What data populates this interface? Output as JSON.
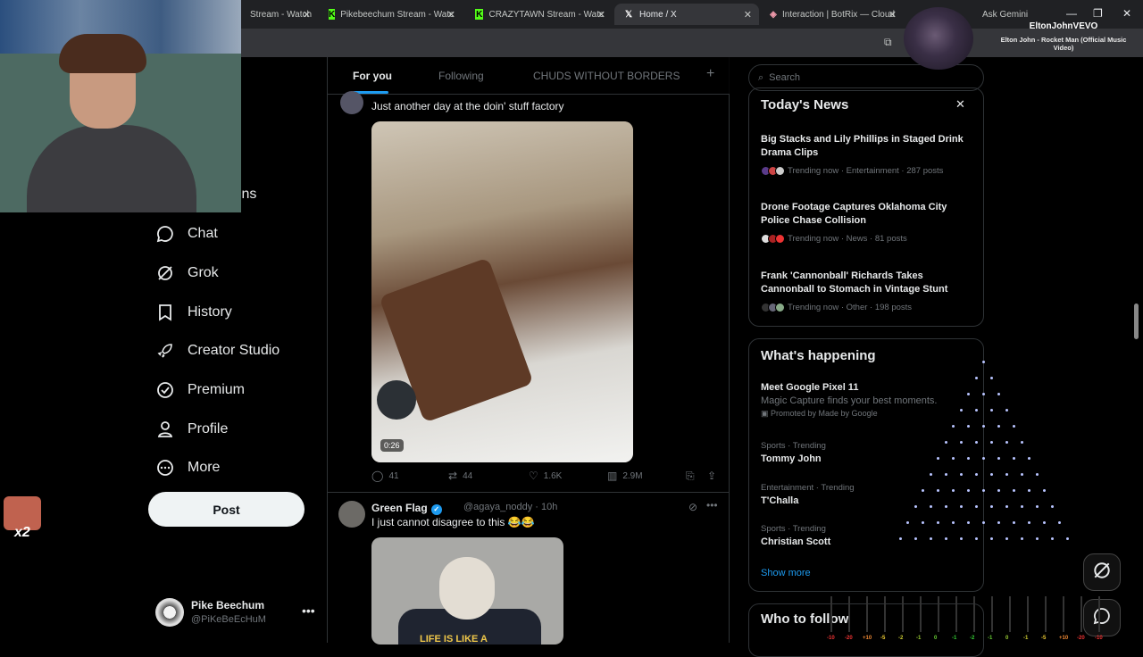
{
  "browser": {
    "tabs": [
      {
        "label": "Stream - Watch",
        "active": false
      },
      {
        "label": "Pikebeechum Stream - Watc",
        "active": false
      },
      {
        "label": "CRAZYTAWN Stream - Watc",
        "active": false
      },
      {
        "label": "Home / X",
        "active": true
      },
      {
        "label": "Interaction | BotRix — Cloud",
        "active": false
      }
    ],
    "ask_gemini": "Ask Gemini"
  },
  "now_playing": {
    "artist": "EltonJohnVEVO",
    "title": "Elton John - Rocket Man (Official Music Video)"
  },
  "nav": {
    "partial_label": "ions",
    "items": [
      {
        "label": "Chat",
        "icon": "chat-bubble-icon"
      },
      {
        "label": "Grok",
        "icon": "grok-icon"
      },
      {
        "label": "History",
        "icon": "bookmark-icon"
      },
      {
        "label": "Creator Studio",
        "icon": "rocket-icon"
      },
      {
        "label": "Premium",
        "icon": "verified-badge-icon"
      },
      {
        "label": "Profile",
        "icon": "person-icon"
      },
      {
        "label": "More",
        "icon": "more-circle-icon"
      }
    ],
    "post_label": "Post"
  },
  "account": {
    "name": "Pike Beechum",
    "handle": "@PiKeBeEcHuM"
  },
  "emote": {
    "count": "x2"
  },
  "feed": {
    "tabs": [
      "For you",
      "Following",
      "CHUDS WITHOUT BORDERS"
    ],
    "tweet1": {
      "text": "Just another day at the doin' stuff factory",
      "duration": "0:26",
      "replies": "41",
      "reposts": "44",
      "likes": "1.6K",
      "views": "2.9M"
    },
    "tweet2": {
      "name": "Green Flag",
      "handle": "@agaya_noddy · 10h",
      "text": "I just cannot disagree to this 😂😂",
      "shirt_text": "LIFE IS LIKE A"
    }
  },
  "sidebar": {
    "search_placeholder": "Search",
    "todays_news_title": "Today's News",
    "news": [
      {
        "title": "Big Stacks and Lily Phillips in Staged Drink Drama Clips",
        "meta": "Trending now · Entertainment · 287 posts"
      },
      {
        "title": "Drone Footage Captures Oklahoma City Police Chase Collision",
        "meta": "Trending now · News · 81 posts"
      },
      {
        "title": "Frank 'Cannonball' Richards Takes Cannonball to Stomach in Vintage Stunt",
        "meta": "Trending now · Other · 198 posts"
      }
    ],
    "whats_happening_title": "What's happening",
    "promo": {
      "title": "Meet Google Pixel 11",
      "subtitle": "Magic Capture finds your best moments.",
      "promoted": "Promoted by Made by Google"
    },
    "trends": [
      {
        "context": "Sports · Trending",
        "name": "Tommy John"
      },
      {
        "context": "Entertainment · Trending",
        "name": "T'Challa"
      },
      {
        "context": "Sports · Trending",
        "name": "Christian Scott"
      }
    ],
    "show_more": "Show more",
    "who_to_follow": "Who to follow"
  },
  "meter_labels": [
    "-10",
    "-20",
    "+10",
    "-5",
    "-2",
    "-1",
    "0",
    "-1",
    "-2",
    "-1",
    "0",
    "-1",
    "-5",
    "+10",
    "-20",
    "-10"
  ]
}
